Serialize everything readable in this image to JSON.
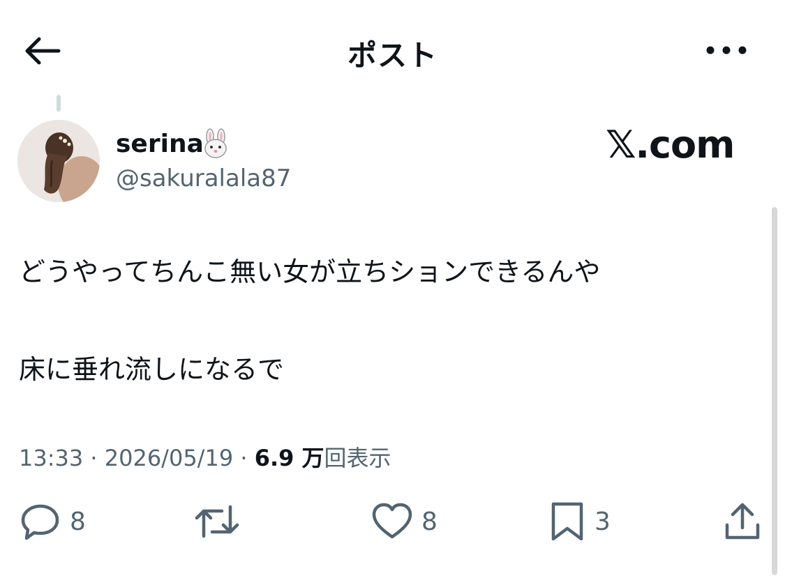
{
  "header": {
    "title": "ポスト",
    "back_icon": "arrow-left-icon",
    "more_icon": "more-horizontal-icon"
  },
  "post": {
    "author": {
      "display_name": "serina",
      "emoji": "rabbit-face-icon",
      "handle": "@sakuralala87"
    },
    "watermark": "𝕏.com",
    "lines": [
      "どうやってちんこ無い女が立ちションできるんや",
      "床に垂れ流しになるで"
    ],
    "meta": {
      "time": "13:33",
      "separator": " · ",
      "date": "2026/05/19",
      "views_count": "6.9 万",
      "views_label": "回表示"
    },
    "actions": {
      "reply_count": "8",
      "like_count": "8",
      "bookmark_count": "3"
    }
  },
  "colors": {
    "text": "#0f1419",
    "secondary": "#536471",
    "background": "#ffffff",
    "scrollbar": "#d8d8d8"
  }
}
